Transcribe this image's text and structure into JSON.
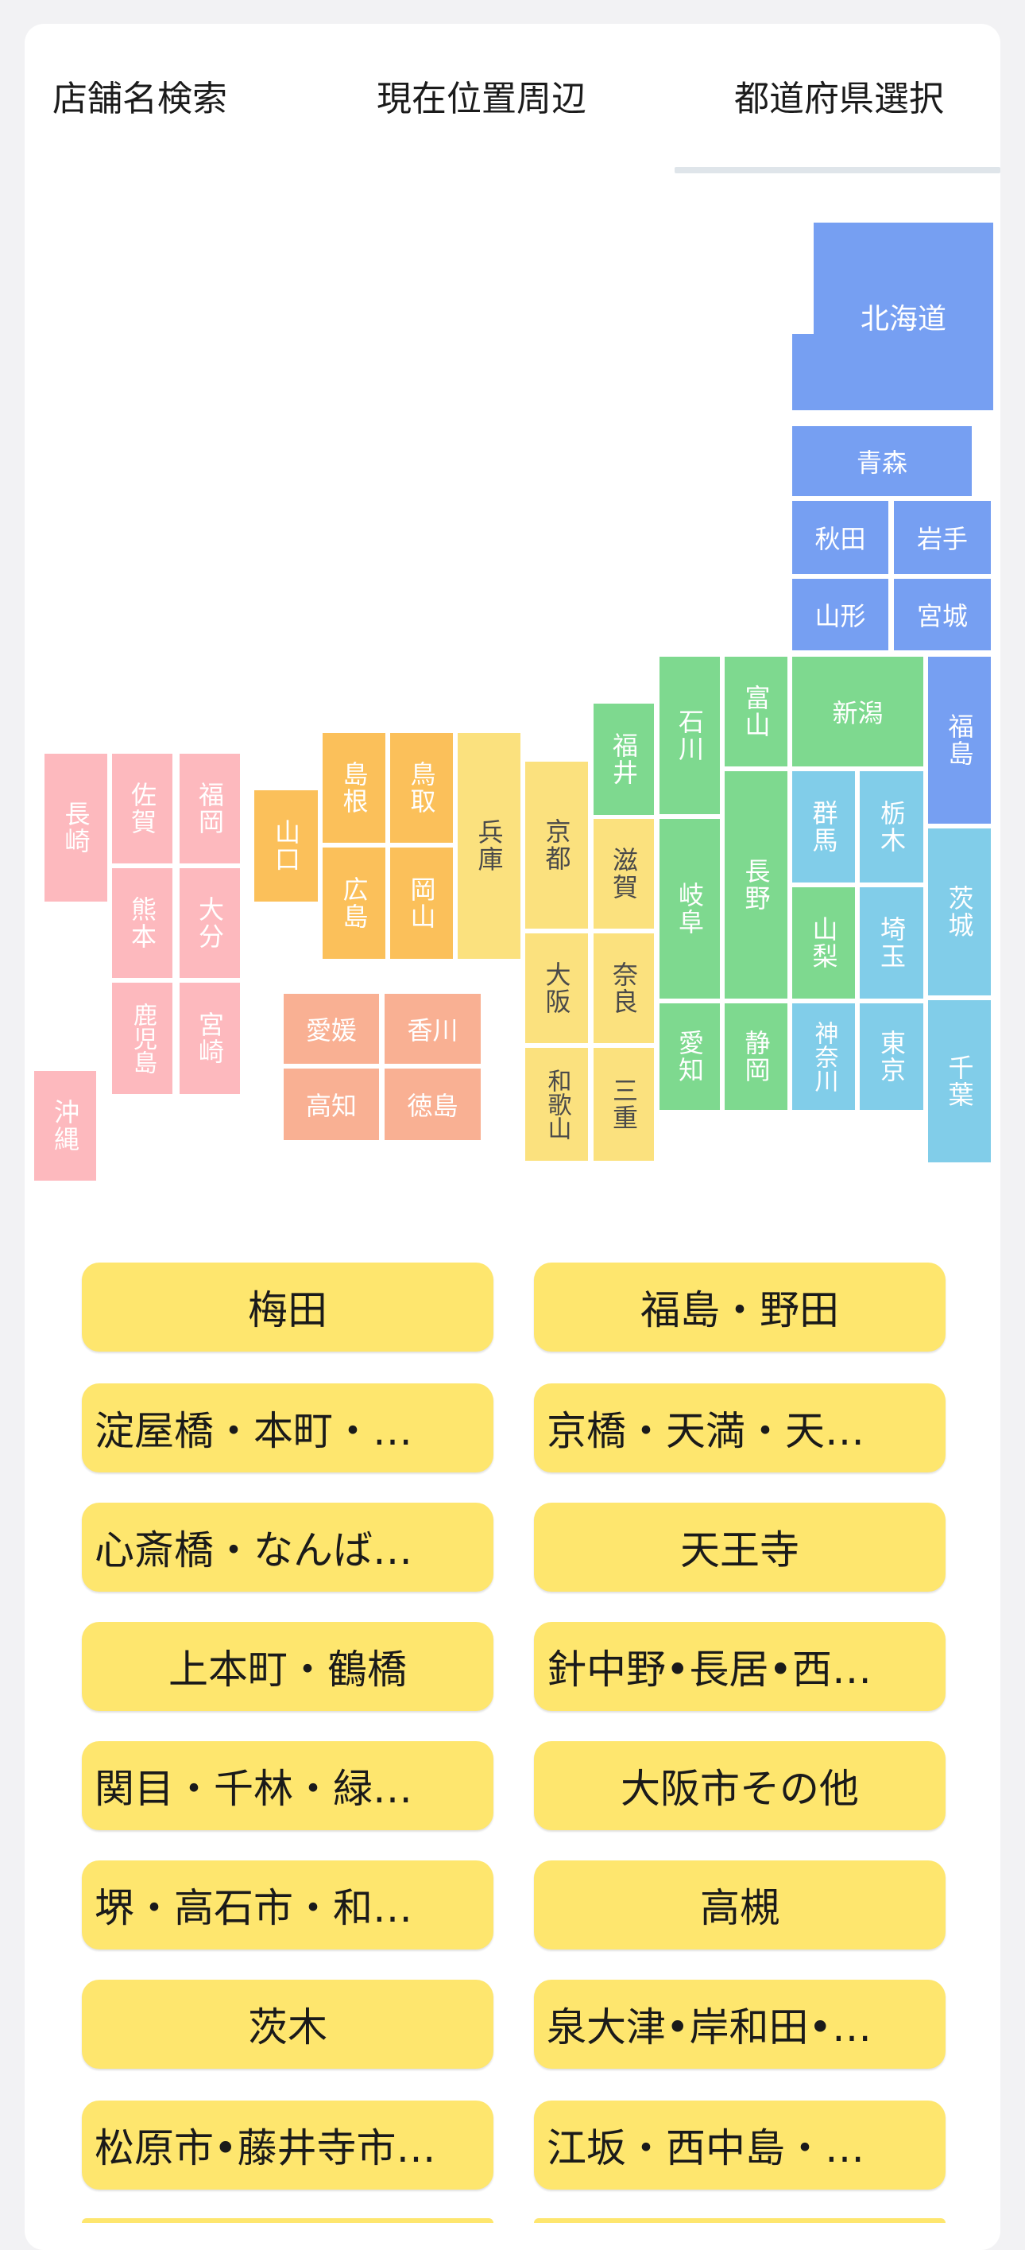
{
  "tabs": [
    {
      "label": "店舗名検索"
    },
    {
      "label": "現在位置周辺"
    },
    {
      "label": "都道府県選択"
    }
  ],
  "active_tab": "都道府県選択",
  "region_colors": {
    "tohoku_hokkaido": "#769ff2",
    "kanto": "#81cde9",
    "chubu": "#7ed98f",
    "kinki": "#fbe17e",
    "chugoku": "#fbc05a",
    "shikoku": "#f9b093",
    "kyushu_okinawa": "#fdb9be"
  },
  "prefectures": {
    "hokkaido": "北海道",
    "aomori": "青森",
    "akita": "秋田",
    "iwate": "岩手",
    "yamagata": "山形",
    "miyagi": "宮城",
    "fukushima": "福島",
    "ibaraki": "茨城",
    "chiba": "千葉",
    "tochigi": "栃木",
    "gunma": "群馬",
    "saitama": "埼玉",
    "tokyo": "東京",
    "kanagawa": "神奈川",
    "niigata": "新潟",
    "toyama": "富山",
    "ishikawa": "石川",
    "fukui": "福井",
    "nagano": "長野",
    "yamanashi": "山梨",
    "gifu": "岐阜",
    "shizuoka": "静岡",
    "aichi": "愛知",
    "kyoto": "京都",
    "shiga": "滋賀",
    "osaka": "大阪",
    "nara": "奈良",
    "wakayama": "和歌山",
    "mie": "三重",
    "hyogo": "兵庫",
    "tottori": "鳥取",
    "shimane": "島根",
    "okayama": "岡山",
    "hiroshima": "広島",
    "yamaguchi": "山口",
    "ehime": "愛媛",
    "kagawa": "香川",
    "kochi": "高知",
    "tokushima": "徳島",
    "fukuoka": "福岡",
    "saga": "佐賀",
    "nagasaki": "長崎",
    "kumamoto": "熊本",
    "oita": "大分",
    "miyazaki": "宮崎",
    "kagoshima": "鹿児島",
    "okinawa": "沖縄"
  },
  "areas": [
    {
      "label": "梅田"
    },
    {
      "label": "福島・野田"
    },
    {
      "label": "淀屋橋・本町・…"
    },
    {
      "label": "京橋・天満・天…"
    },
    {
      "label": "心斎橋・なんば…"
    },
    {
      "label": "天王寺"
    },
    {
      "label": "上本町・鶴橋"
    },
    {
      "label": "針中野•長居•西…"
    },
    {
      "label": "関目・千林・緑…"
    },
    {
      "label": "大阪市その他"
    },
    {
      "label": "堺・高石市・和…"
    },
    {
      "label": "高槻"
    },
    {
      "label": "茨木"
    },
    {
      "label": "泉大津•岸和田•…"
    },
    {
      "label": "松原市•藤井寺市…"
    },
    {
      "label": "江坂・西中島・…"
    }
  ],
  "button_color": "#fee66e"
}
